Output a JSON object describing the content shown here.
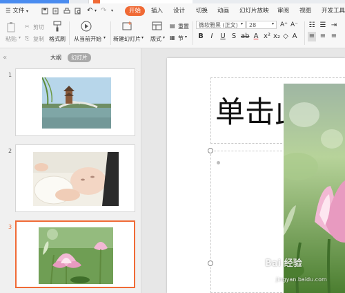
{
  "menubar": {
    "file_label": "文件",
    "tabs": [
      "开始",
      "插入",
      "设计",
      "切换",
      "动画",
      "幻灯片放映",
      "审阅",
      "视图",
      "开发工具"
    ],
    "active_tab": "开始"
  },
  "ribbon": {
    "paste": "粘贴",
    "cut": "剪切",
    "copy": "复制",
    "format_painter": "格式刷",
    "from_current": "从当前开始",
    "new_slide": "新建幻灯片",
    "layout": "版式",
    "reset": "重置",
    "section": "节",
    "font_name": "微软雅黑 (正文)",
    "font_size": "28"
  },
  "panel": {
    "outline_tab": "大纲",
    "slides_tab": "幻灯片",
    "slides": [
      {
        "number": "1",
        "image": "bridge-pagoda-lake-photo"
      },
      {
        "number": "2",
        "image": "sleeping-baby-photo"
      },
      {
        "number": "3",
        "image": "pink-lotus-flower-photo"
      }
    ],
    "selected_index": 3
  },
  "slide": {
    "title_text": "单击此"
  },
  "watermark": {
    "text": "Bai 经验",
    "url": "jingyan.baidu.com"
  },
  "colors": {
    "accent": "#f06a35",
    "lotus_pink": "#e89ac0",
    "leaf_green": "#4a8a2e"
  }
}
